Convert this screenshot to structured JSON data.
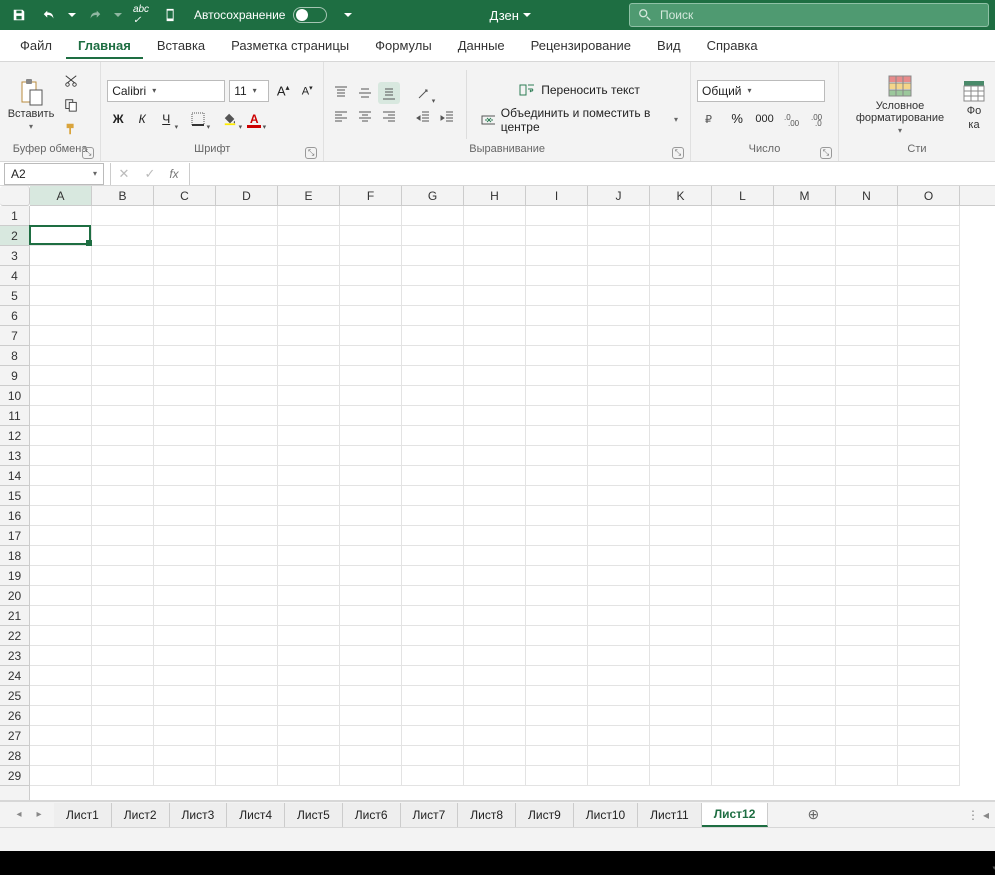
{
  "titlebar": {
    "autosave_label": "Автосохранение",
    "autosave_on": false,
    "dzen_label": "Дзен",
    "search_placeholder": "Поиск"
  },
  "tabs": {
    "file": "Файл",
    "home": "Главная",
    "insert": "Вставка",
    "layout": "Разметка страницы",
    "formulas": "Формулы",
    "data": "Данные",
    "review": "Рецензирование",
    "view": "Вид",
    "help": "Справка",
    "active": "home"
  },
  "ribbon": {
    "clipboard": {
      "paste": "Вставить",
      "label": "Буфер обмена"
    },
    "font": {
      "name": "Calibri",
      "size": "11",
      "label": "Шрифт"
    },
    "alignment": {
      "wrap": "Переносить текст",
      "merge": "Объединить и поместить в центре",
      "label": "Выравнивание"
    },
    "number": {
      "format": "Общий",
      "label": "Число"
    },
    "styles": {
      "cf": "Условное форматирование",
      "format_as": "Фо",
      "as_table": "ка",
      "label": "Сти"
    }
  },
  "formula_bar": {
    "cell_ref": "A2",
    "formula": ""
  },
  "grid": {
    "columns": [
      "A",
      "B",
      "C",
      "D",
      "E",
      "F",
      "G",
      "H",
      "I",
      "J",
      "K",
      "L",
      "M",
      "N",
      "O"
    ],
    "row_count": 29,
    "active_cell": "A2",
    "active_col": "A",
    "active_row": 2
  },
  "sheets": {
    "tabs": [
      "Лист1",
      "Лист2",
      "Лист3",
      "Лист4",
      "Лист5",
      "Лист6",
      "Лист7",
      "Лист8",
      "Лист9",
      "Лист10",
      "Лист11",
      "Лист12"
    ],
    "active": "Лист12"
  }
}
